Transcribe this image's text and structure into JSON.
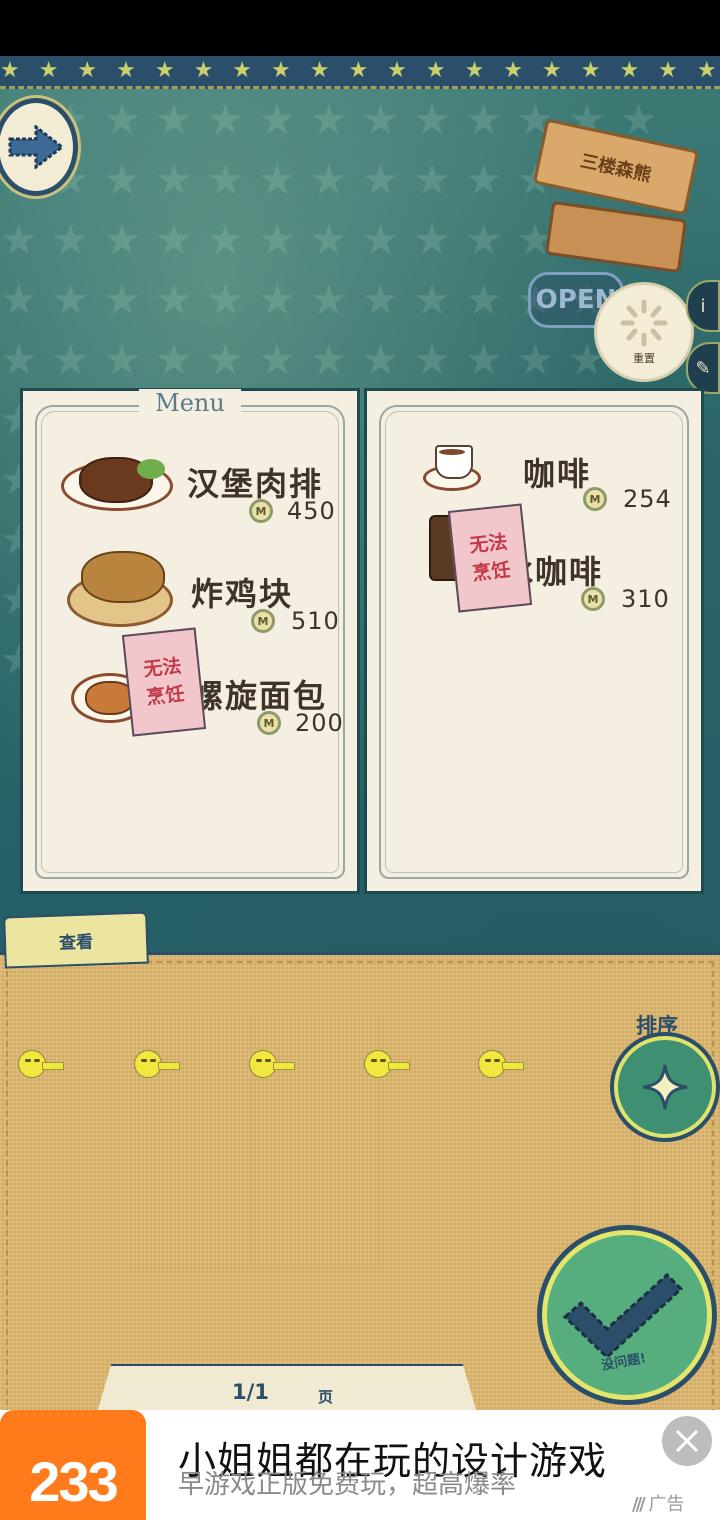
{
  "menu": {
    "title": "Menu",
    "left_items": [
      {
        "name": "汉堡肉排",
        "price": "450",
        "cookable": true,
        "icon": "hamburg-steak"
      },
      {
        "name": "炸鸡块",
        "price": "510",
        "cookable": true,
        "icon": "fried-chicken"
      },
      {
        "name": "螺旋面包",
        "price": "200",
        "cookable": false,
        "icon": "spiral-bread"
      }
    ],
    "right_items": [
      {
        "name": "咖啡",
        "price": "254",
        "cookable": true,
        "icon": "coffee"
      },
      {
        "name": "冰咖啡",
        "price": "310",
        "cookable": false,
        "icon": "iced-coffee"
      }
    ],
    "cannot_cook_label": "无法\n烹饪",
    "coin_symbol": "M"
  },
  "scene": {
    "sign_text": "三楼森熊",
    "open_text": "OPEN",
    "reset_label": "重置"
  },
  "tray": {
    "view_tab": "查看",
    "sort_label": "排序",
    "confirm_label": "没问题!",
    "page": "1/1",
    "page_unit": "页",
    "customer_count": 5
  },
  "ad": {
    "logo": "233",
    "title": "小姐姐都在玩的设计游戏",
    "subtitle": "早游戏正版免费玩，超高爆率",
    "tag": "广告"
  },
  "colors": {
    "panel": "#f4efe1",
    "frame": "#1d4a4f",
    "tray": "#ddb66c",
    "accent": "#2b4e6a",
    "ad_orange": "#ff7a1a"
  }
}
